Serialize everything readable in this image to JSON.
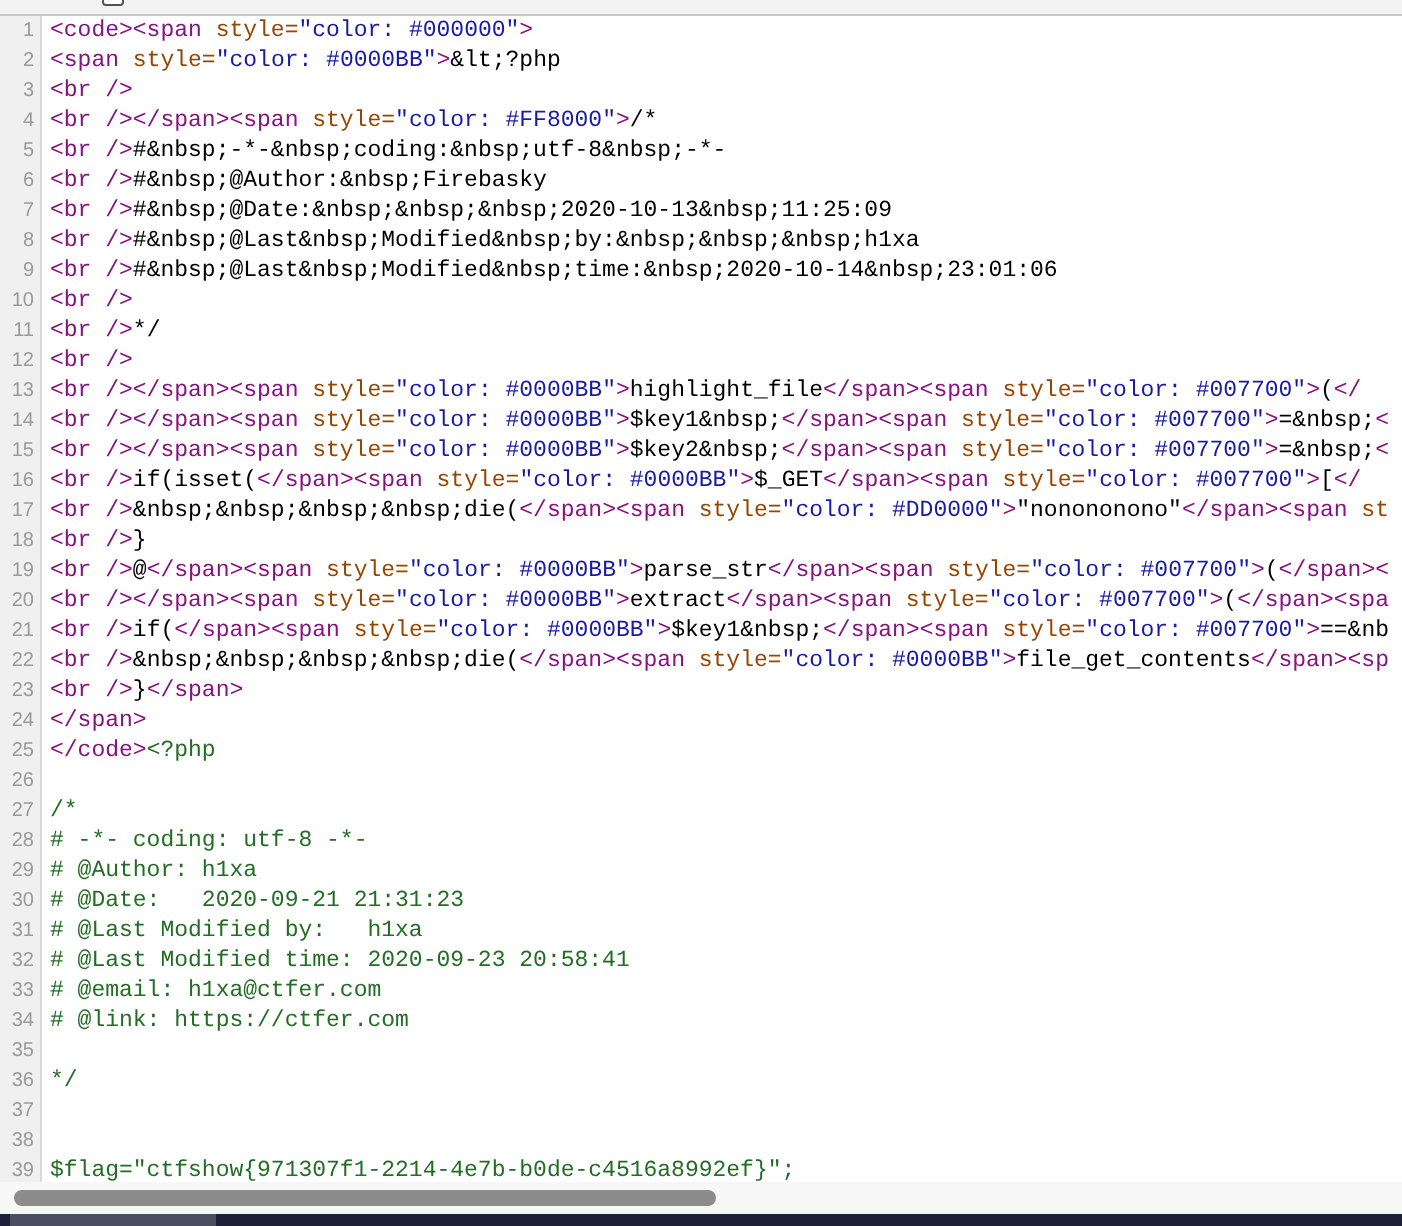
{
  "toolbar": {
    "wrap_toggle": {
      "checked": false
    }
  },
  "lines": [
    {
      "number": "1",
      "segments": [
        {
          "kind": "tag",
          "text": "<code><span "
        },
        {
          "kind": "attr",
          "text": "style="
        },
        {
          "kind": "value",
          "text": "\"color: #000000\""
        },
        {
          "kind": "tag",
          "text": ">"
        }
      ]
    },
    {
      "number": "2",
      "segments": [
        {
          "kind": "tag",
          "text": "<span "
        },
        {
          "kind": "attr",
          "text": "style="
        },
        {
          "kind": "value",
          "text": "\"color: #0000BB\""
        },
        {
          "kind": "tag",
          "text": ">"
        },
        {
          "kind": "text",
          "text": "&lt;?php"
        }
      ]
    },
    {
      "number": "3",
      "segments": [
        {
          "kind": "tag",
          "text": "<br />"
        }
      ]
    },
    {
      "number": "4",
      "segments": [
        {
          "kind": "tag",
          "text": "<br /></span><span "
        },
        {
          "kind": "attr",
          "text": "style="
        },
        {
          "kind": "value",
          "text": "\"color: #FF8000\""
        },
        {
          "kind": "tag",
          "text": ">"
        },
        {
          "kind": "text",
          "text": "/*"
        }
      ]
    },
    {
      "number": "5",
      "segments": [
        {
          "kind": "tag",
          "text": "<br />"
        },
        {
          "kind": "text",
          "text": "#&nbsp;-*-&nbsp;coding:&nbsp;utf-8&nbsp;-*-"
        }
      ]
    },
    {
      "number": "6",
      "segments": [
        {
          "kind": "tag",
          "text": "<br />"
        },
        {
          "kind": "text",
          "text": "#&nbsp;@Author:&nbsp;Firebasky"
        }
      ]
    },
    {
      "number": "7",
      "segments": [
        {
          "kind": "tag",
          "text": "<br />"
        },
        {
          "kind": "text",
          "text": "#&nbsp;@Date:&nbsp;&nbsp;&nbsp;2020-10-13&nbsp;11:25:09"
        }
      ]
    },
    {
      "number": "8",
      "segments": [
        {
          "kind": "tag",
          "text": "<br />"
        },
        {
          "kind": "text",
          "text": "#&nbsp;@Last&nbsp;Modified&nbsp;by:&nbsp;&nbsp;&nbsp;h1xa"
        }
      ]
    },
    {
      "number": "9",
      "segments": [
        {
          "kind": "tag",
          "text": "<br />"
        },
        {
          "kind": "text",
          "text": "#&nbsp;@Last&nbsp;Modified&nbsp;time:&nbsp;2020-10-14&nbsp;23:01:06"
        }
      ]
    },
    {
      "number": "10",
      "segments": [
        {
          "kind": "tag",
          "text": "<br />"
        }
      ]
    },
    {
      "number": "11",
      "segments": [
        {
          "kind": "tag",
          "text": "<br />"
        },
        {
          "kind": "text",
          "text": "*/"
        }
      ]
    },
    {
      "number": "12",
      "segments": [
        {
          "kind": "tag",
          "text": "<br />"
        }
      ]
    },
    {
      "number": "13",
      "segments": [
        {
          "kind": "tag",
          "text": "<br /></span><span "
        },
        {
          "kind": "attr",
          "text": "style="
        },
        {
          "kind": "value",
          "text": "\"color: #0000BB\""
        },
        {
          "kind": "tag",
          "text": ">"
        },
        {
          "kind": "text",
          "text": "highlight_file"
        },
        {
          "kind": "tag",
          "text": "</span><span "
        },
        {
          "kind": "attr",
          "text": "style="
        },
        {
          "kind": "value",
          "text": "\"color: #007700\""
        },
        {
          "kind": "tag",
          "text": ">"
        },
        {
          "kind": "text",
          "text": "("
        },
        {
          "kind": "tag",
          "text": "</"
        }
      ]
    },
    {
      "number": "14",
      "segments": [
        {
          "kind": "tag",
          "text": "<br /></span><span "
        },
        {
          "kind": "attr",
          "text": "style="
        },
        {
          "kind": "value",
          "text": "\"color: #0000BB\""
        },
        {
          "kind": "tag",
          "text": ">"
        },
        {
          "kind": "text",
          "text": "$key1&nbsp;"
        },
        {
          "kind": "tag",
          "text": "</span><span "
        },
        {
          "kind": "attr",
          "text": "style="
        },
        {
          "kind": "value",
          "text": "\"color: #007700\""
        },
        {
          "kind": "tag",
          "text": ">"
        },
        {
          "kind": "text",
          "text": "=&nbsp;"
        },
        {
          "kind": "tag",
          "text": "<"
        }
      ]
    },
    {
      "number": "15",
      "segments": [
        {
          "kind": "tag",
          "text": "<br /></span><span "
        },
        {
          "kind": "attr",
          "text": "style="
        },
        {
          "kind": "value",
          "text": "\"color: #0000BB\""
        },
        {
          "kind": "tag",
          "text": ">"
        },
        {
          "kind": "text",
          "text": "$key2&nbsp;"
        },
        {
          "kind": "tag",
          "text": "</span><span "
        },
        {
          "kind": "attr",
          "text": "style="
        },
        {
          "kind": "value",
          "text": "\"color: #007700\""
        },
        {
          "kind": "tag",
          "text": ">"
        },
        {
          "kind": "text",
          "text": "=&nbsp;"
        },
        {
          "kind": "tag",
          "text": "<"
        }
      ]
    },
    {
      "number": "16",
      "segments": [
        {
          "kind": "tag",
          "text": "<br />"
        },
        {
          "kind": "text",
          "text": "if(isset("
        },
        {
          "kind": "tag",
          "text": "</span><span "
        },
        {
          "kind": "attr",
          "text": "style="
        },
        {
          "kind": "value",
          "text": "\"color: #0000BB\""
        },
        {
          "kind": "tag",
          "text": ">"
        },
        {
          "kind": "text",
          "text": "$_GET"
        },
        {
          "kind": "tag",
          "text": "</span><span "
        },
        {
          "kind": "attr",
          "text": "style="
        },
        {
          "kind": "value",
          "text": "\"color: #007700\""
        },
        {
          "kind": "tag",
          "text": ">"
        },
        {
          "kind": "text",
          "text": "["
        },
        {
          "kind": "tag",
          "text": "</"
        }
      ]
    },
    {
      "number": "17",
      "segments": [
        {
          "kind": "tag",
          "text": "<br />"
        },
        {
          "kind": "text",
          "text": "&nbsp;&nbsp;&nbsp;&nbsp;die("
        },
        {
          "kind": "tag",
          "text": "</span><span "
        },
        {
          "kind": "attr",
          "text": "style="
        },
        {
          "kind": "value",
          "text": "\"color: #DD0000\""
        },
        {
          "kind": "tag",
          "text": ">"
        },
        {
          "kind": "text",
          "text": "\"nonononono\""
        },
        {
          "kind": "tag",
          "text": "</span><span "
        },
        {
          "kind": "attr",
          "text": "st"
        }
      ]
    },
    {
      "number": "18",
      "segments": [
        {
          "kind": "tag",
          "text": "<br />"
        },
        {
          "kind": "text",
          "text": "}"
        }
      ]
    },
    {
      "number": "19",
      "segments": [
        {
          "kind": "tag",
          "text": "<br />"
        },
        {
          "kind": "text",
          "text": "@"
        },
        {
          "kind": "tag",
          "text": "</span><span "
        },
        {
          "kind": "attr",
          "text": "style="
        },
        {
          "kind": "value",
          "text": "\"color: #0000BB\""
        },
        {
          "kind": "tag",
          "text": ">"
        },
        {
          "kind": "text",
          "text": "parse_str"
        },
        {
          "kind": "tag",
          "text": "</span><span "
        },
        {
          "kind": "attr",
          "text": "style="
        },
        {
          "kind": "value",
          "text": "\"color: #007700\""
        },
        {
          "kind": "tag",
          "text": ">"
        },
        {
          "kind": "text",
          "text": "("
        },
        {
          "kind": "tag",
          "text": "</span><"
        }
      ]
    },
    {
      "number": "20",
      "segments": [
        {
          "kind": "tag",
          "text": "<br /></span><span "
        },
        {
          "kind": "attr",
          "text": "style="
        },
        {
          "kind": "value",
          "text": "\"color: #0000BB\""
        },
        {
          "kind": "tag",
          "text": ">"
        },
        {
          "kind": "text",
          "text": "extract"
        },
        {
          "kind": "tag",
          "text": "</span><span "
        },
        {
          "kind": "attr",
          "text": "style="
        },
        {
          "kind": "value",
          "text": "\"color: #007700\""
        },
        {
          "kind": "tag",
          "text": ">"
        },
        {
          "kind": "text",
          "text": "("
        },
        {
          "kind": "tag",
          "text": "</span><spa"
        }
      ]
    },
    {
      "number": "21",
      "segments": [
        {
          "kind": "tag",
          "text": "<br />"
        },
        {
          "kind": "text",
          "text": "if("
        },
        {
          "kind": "tag",
          "text": "</span><span "
        },
        {
          "kind": "attr",
          "text": "style="
        },
        {
          "kind": "value",
          "text": "\"color: #0000BB\""
        },
        {
          "kind": "tag",
          "text": ">"
        },
        {
          "kind": "text",
          "text": "$key1&nbsp;"
        },
        {
          "kind": "tag",
          "text": "</span><span "
        },
        {
          "kind": "attr",
          "text": "style="
        },
        {
          "kind": "value",
          "text": "\"color: #007700\""
        },
        {
          "kind": "tag",
          "text": ">"
        },
        {
          "kind": "text",
          "text": "==&nb"
        }
      ]
    },
    {
      "number": "22",
      "segments": [
        {
          "kind": "tag",
          "text": "<br />"
        },
        {
          "kind": "text",
          "text": "&nbsp;&nbsp;&nbsp;&nbsp;die("
        },
        {
          "kind": "tag",
          "text": "</span><span "
        },
        {
          "kind": "attr",
          "text": "style="
        },
        {
          "kind": "value",
          "text": "\"color: #0000BB\""
        },
        {
          "kind": "tag",
          "text": ">"
        },
        {
          "kind": "text",
          "text": "file_get_contents"
        },
        {
          "kind": "tag",
          "text": "</span><sp"
        }
      ]
    },
    {
      "number": "23",
      "segments": [
        {
          "kind": "tag",
          "text": "<br />"
        },
        {
          "kind": "text",
          "text": "}"
        },
        {
          "kind": "tag",
          "text": "</span>"
        }
      ]
    },
    {
      "number": "24",
      "segments": [
        {
          "kind": "tag",
          "text": "</span>"
        }
      ]
    },
    {
      "number": "25",
      "segments": [
        {
          "kind": "tag",
          "text": "</code>"
        },
        {
          "kind": "comment",
          "text": "<?php"
        }
      ]
    },
    {
      "number": "26"
    },
    {
      "number": "27",
      "segments": [
        {
          "kind": "comment",
          "text": "/*"
        }
      ]
    },
    {
      "number": "28",
      "segments": [
        {
          "kind": "comment",
          "text": "# -*- coding: utf-8 -*-"
        }
      ]
    },
    {
      "number": "29",
      "segments": [
        {
          "kind": "comment",
          "text": "# @Author: h1xa"
        }
      ]
    },
    {
      "number": "30",
      "segments": [
        {
          "kind": "comment",
          "text": "# @Date:   2020-09-21 21:31:23"
        }
      ]
    },
    {
      "number": "31",
      "segments": [
        {
          "kind": "comment",
          "text": "# @Last Modified by:   h1xa"
        }
      ]
    },
    {
      "number": "32",
      "segments": [
        {
          "kind": "comment",
          "text": "# @Last Modified time: 2020-09-23 20:58:41"
        }
      ]
    },
    {
      "number": "33",
      "segments": [
        {
          "kind": "comment",
          "text": "# @email: h1xa@ctfer.com"
        }
      ]
    },
    {
      "number": "34",
      "segments": [
        {
          "kind": "comment",
          "text": "# @link: https://ctfer.com"
        }
      ]
    },
    {
      "number": "35"
    },
    {
      "number": "36",
      "segments": [
        {
          "kind": "comment",
          "text": "*/"
        }
      ]
    },
    {
      "number": "37"
    },
    {
      "number": "38"
    },
    {
      "number": "39",
      "segments": [
        {
          "kind": "comment",
          "text": "$flag=\"ctfshow{971307f1-2214-4e7b-b0de-c4516a8992ef}\";"
        }
      ]
    }
  ]
}
